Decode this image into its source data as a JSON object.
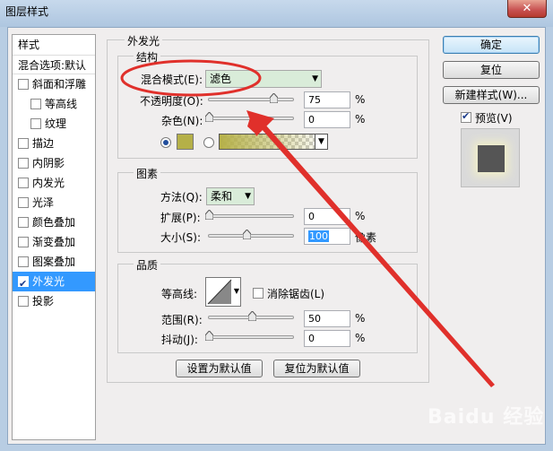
{
  "window": {
    "title": "图层样式",
    "close_glyph": "✕"
  },
  "style_list": {
    "header": "样式",
    "blend_options": "混合选项:默认",
    "items": [
      {
        "label": "斜面和浮雕",
        "checked": false,
        "indent": false
      },
      {
        "label": "等高线",
        "checked": false,
        "indent": true
      },
      {
        "label": "纹理",
        "checked": false,
        "indent": true
      },
      {
        "label": "描边",
        "checked": false,
        "indent": false
      },
      {
        "label": "内阴影",
        "checked": false,
        "indent": false
      },
      {
        "label": "内发光",
        "checked": false,
        "indent": false
      },
      {
        "label": "光泽",
        "checked": false,
        "indent": false
      },
      {
        "label": "颜色叠加",
        "checked": false,
        "indent": false
      },
      {
        "label": "渐变叠加",
        "checked": false,
        "indent": false
      },
      {
        "label": "图案叠加",
        "checked": false,
        "indent": false
      },
      {
        "label": "外发光",
        "checked": true,
        "indent": false,
        "selected": true
      },
      {
        "label": "投影",
        "checked": false,
        "indent": false
      }
    ]
  },
  "outer_glow": {
    "title": "外发光",
    "structure": {
      "title": "结构",
      "blend_mode_label": "混合模式(E):",
      "blend_mode_value": "滤色",
      "opacity_label": "不透明度(O):",
      "opacity_value": "75",
      "noise_label": "杂色(N):",
      "noise_value": "0",
      "unit": "%",
      "glow_color": "#b5b048"
    },
    "elements": {
      "title": "图素",
      "technique_label": "方法(Q):",
      "technique_value": "柔和",
      "spread_label": "扩展(P):",
      "spread_value": "0",
      "size_label": "大小(S):",
      "size_value": "100",
      "size_unit": "像素",
      "unit": "%"
    },
    "quality": {
      "title": "品质",
      "contour_label": "等高线:",
      "antialias_label": "消除锯齿(L)",
      "range_label": "范围(R):",
      "range_value": "50",
      "jitter_label": "抖动(J):",
      "jitter_value": "0",
      "unit": "%"
    },
    "make_default": "设置为默认值",
    "reset_default": "复位为默认值"
  },
  "buttons": {
    "ok": "确定",
    "reset": "复位",
    "new_style": "新建样式(W)...",
    "preview_label": "预览(V)"
  },
  "watermark": "Baidu 经验",
  "colors": {
    "highlight": "#3399ff",
    "annotation": "#e0302b"
  }
}
